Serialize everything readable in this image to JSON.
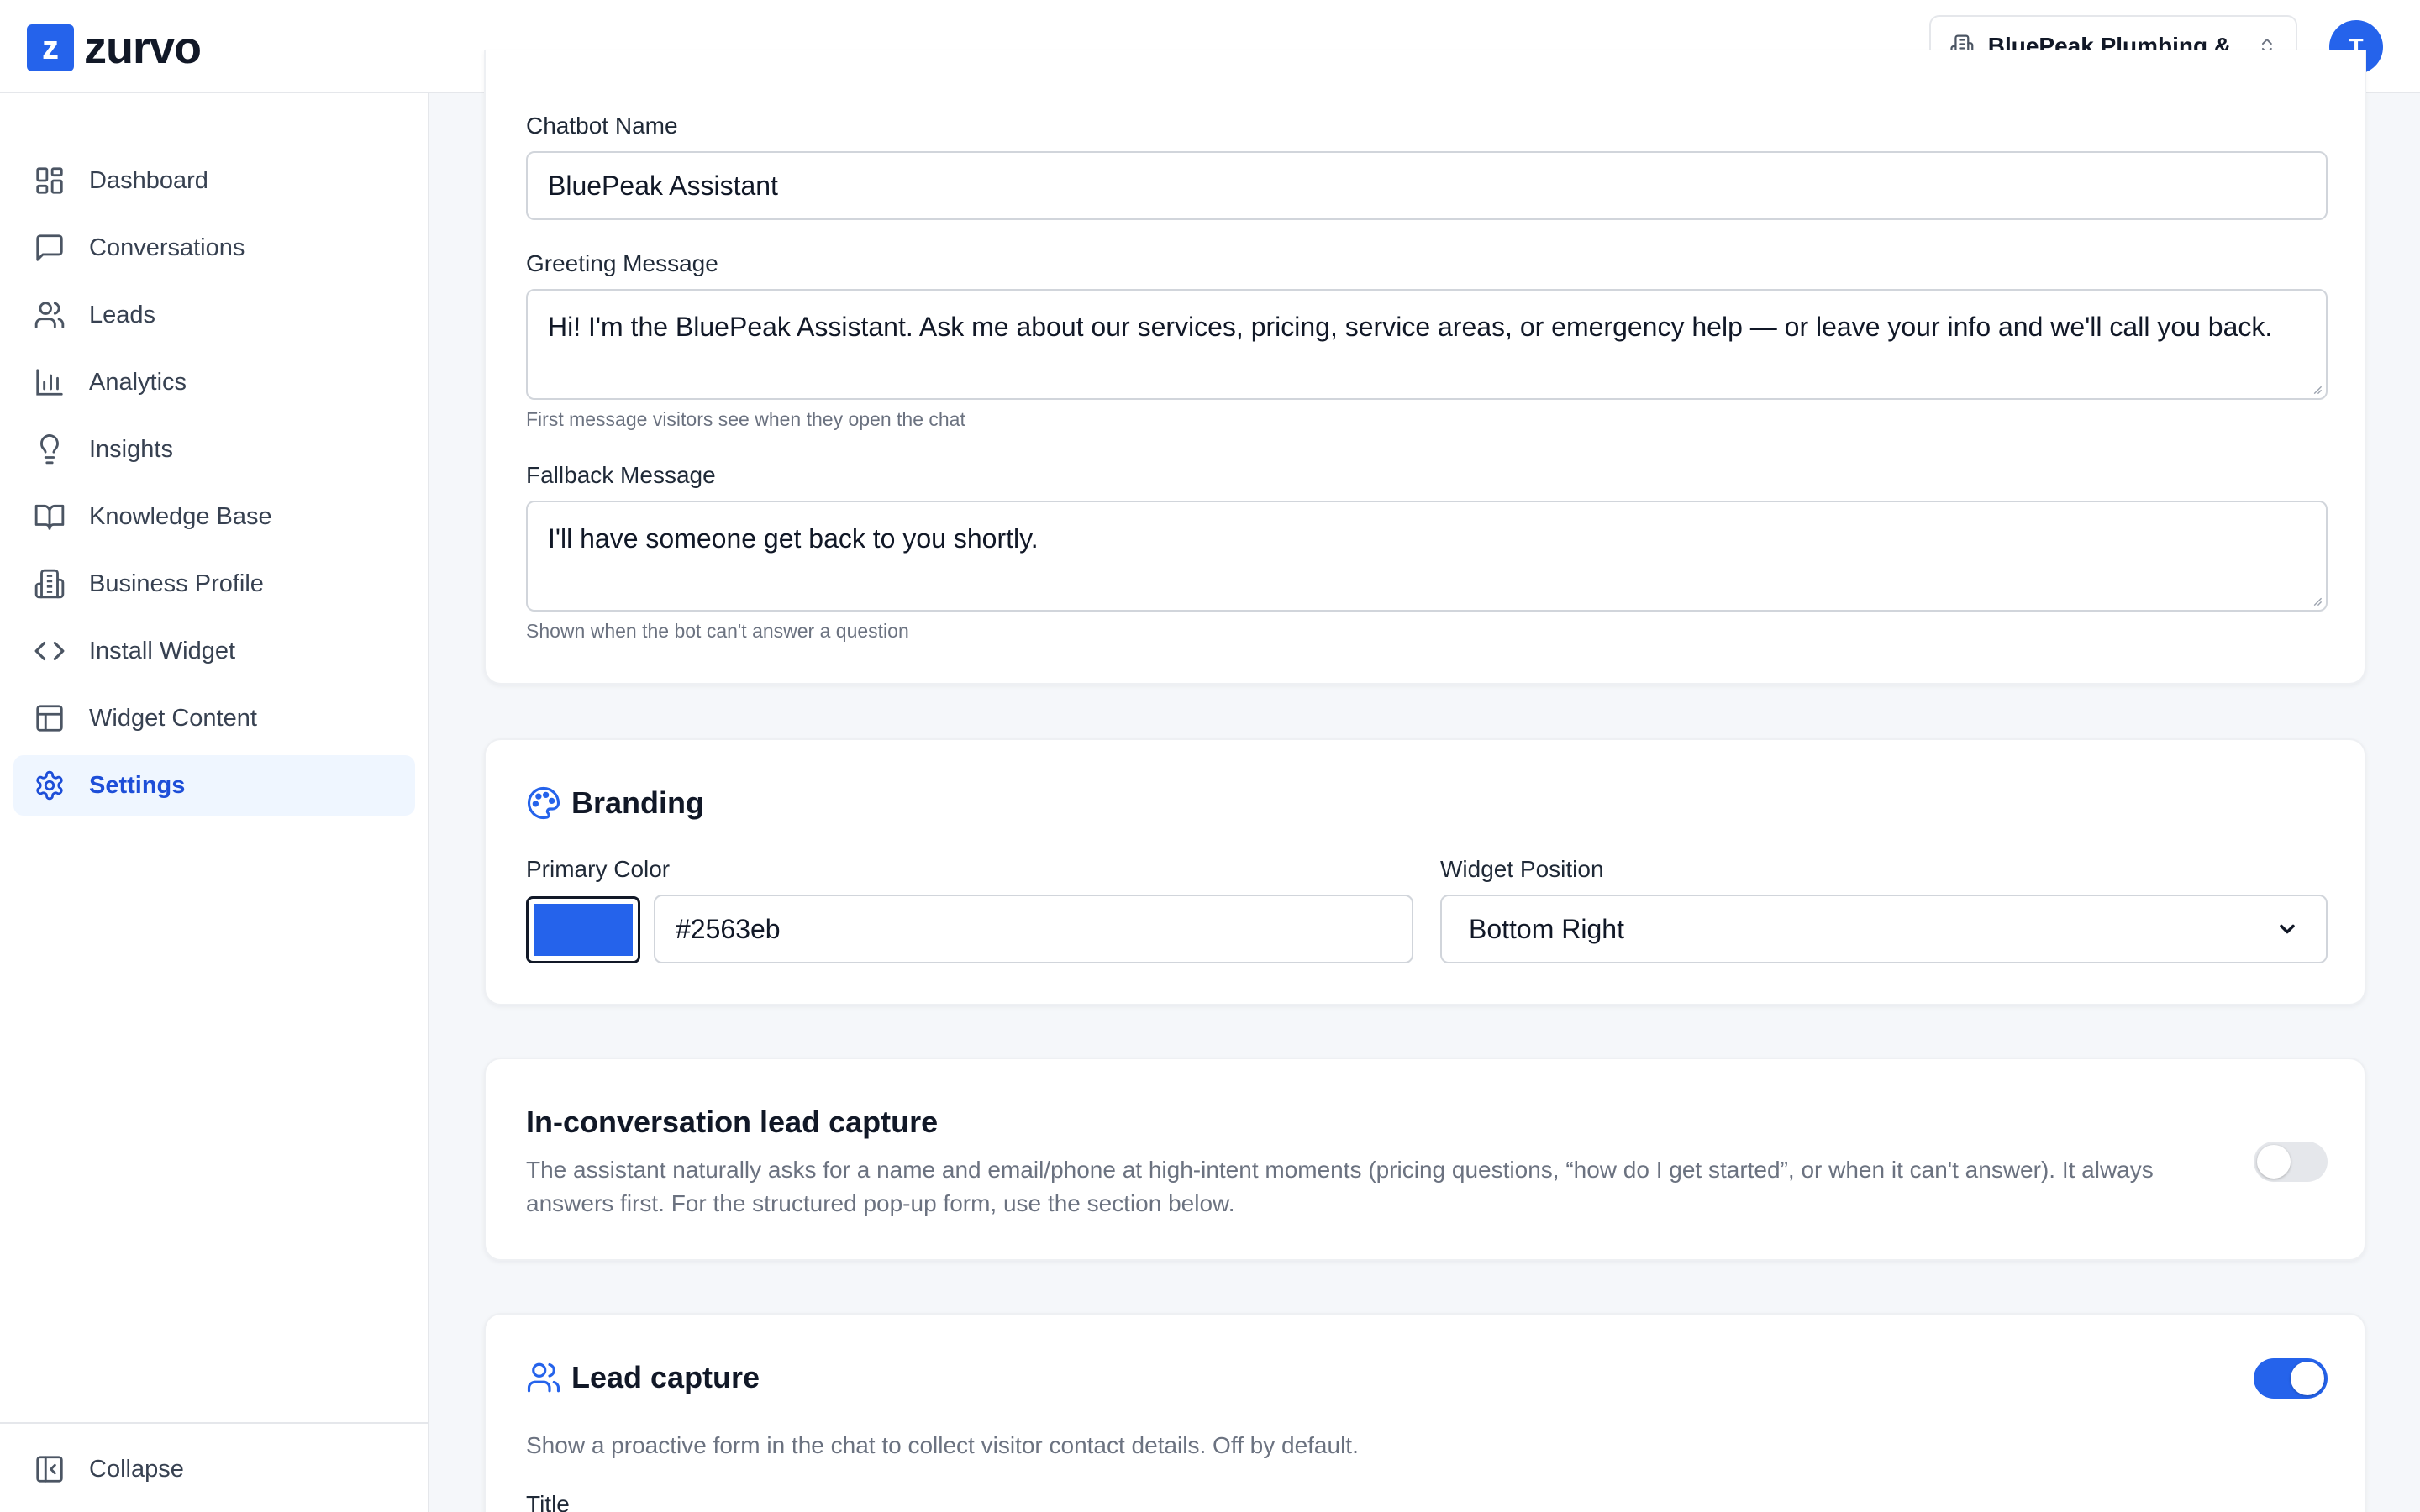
{
  "brand": {
    "logo_letter": "z",
    "name": "zurvo",
    "accent": "#2563eb"
  },
  "header": {
    "business_name": "BluePeak Plumbing & ...",
    "avatar_initial": "T"
  },
  "sidebar": {
    "items": [
      {
        "label": "Dashboard",
        "icon": "dashboard-icon"
      },
      {
        "label": "Conversations",
        "icon": "chat-bubble-icon"
      },
      {
        "label": "Leads",
        "icon": "users-icon"
      },
      {
        "label": "Analytics",
        "icon": "bar-chart-icon"
      },
      {
        "label": "Insights",
        "icon": "lightbulb-icon"
      },
      {
        "label": "Knowledge Base",
        "icon": "book-open-icon"
      },
      {
        "label": "Business Profile",
        "icon": "building-icon"
      },
      {
        "label": "Install Widget",
        "icon": "code-icon"
      },
      {
        "label": "Widget Content",
        "icon": "layout-icon"
      },
      {
        "label": "Settings",
        "icon": "gear-icon",
        "active": true
      }
    ],
    "collapse_label": "Collapse"
  },
  "chatbot": {
    "name_label": "Chatbot Name",
    "name_value": "BluePeak Assistant",
    "greeting_label": "Greeting Message",
    "greeting_value": "Hi! I'm the BluePeak Assistant. Ask me about our services, pricing, service areas, or emergency help — or leave your info and we'll call you back.",
    "greeting_hint": "First message visitors see when they open the chat",
    "fallback_label": "Fallback Message",
    "fallback_value": "I'll have someone get back to you shortly.",
    "fallback_hint": "Shown when the bot can't answer a question"
  },
  "branding": {
    "title": "Branding",
    "primary_color_label": "Primary Color",
    "primary_color_value": "#2563eb",
    "widget_position_label": "Widget Position",
    "widget_position_value": "Bottom Right"
  },
  "inconv_capture": {
    "title": "In-conversation lead capture",
    "description": "The assistant naturally asks for a name and email/phone at high-intent moments (pricing questions, “how do I get started”, or when it can't answer). It always answers first. For the structured pop-up form, use the section below.",
    "enabled": false
  },
  "lead_capture": {
    "title": "Lead capture",
    "description": "Show a proactive form in the chat to collect visitor contact details. Off by default.",
    "enabled": true,
    "title_field_label": "Title"
  }
}
